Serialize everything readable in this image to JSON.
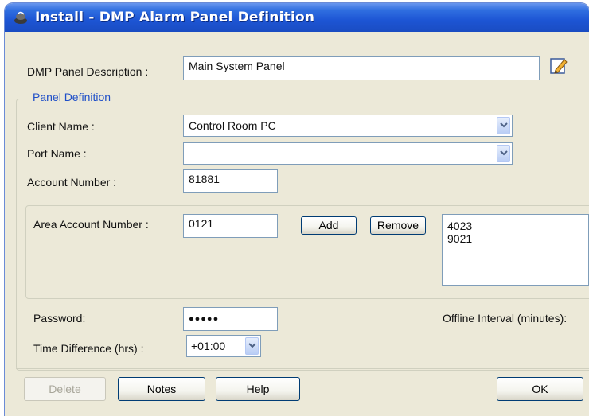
{
  "window": {
    "title": "Install - DMP Alarm Panel Definition"
  },
  "panel_description": {
    "label": "DMP Panel Description :",
    "value": "Main System Panel"
  },
  "panel_definition": {
    "group_label": "Panel Definition",
    "client_name": {
      "label": "Client Name :",
      "value": "Control Room PC"
    },
    "port_name": {
      "label": "Port Name :",
      "value": ""
    },
    "account_number": {
      "label": "Account Number :",
      "value": "81881"
    }
  },
  "area_account": {
    "label": "Area Account Number :",
    "value": "0121",
    "add_label": "Add",
    "remove_label": "Remove",
    "list": [
      "4023",
      "9021"
    ]
  },
  "password": {
    "label": "Password:",
    "masked": "●●●●●"
  },
  "offline_interval": {
    "label": "Offline Interval (minutes):"
  },
  "time_difference": {
    "label": "Time Difference (hrs) :",
    "value": "+01:00"
  },
  "buttons": {
    "delete": "Delete",
    "notes": "Notes",
    "help": "Help",
    "ok": "OK"
  },
  "icons": {
    "title": "install-icon",
    "edit": "edit-pencil-icon",
    "dropdown": "chevron-down-icon"
  }
}
